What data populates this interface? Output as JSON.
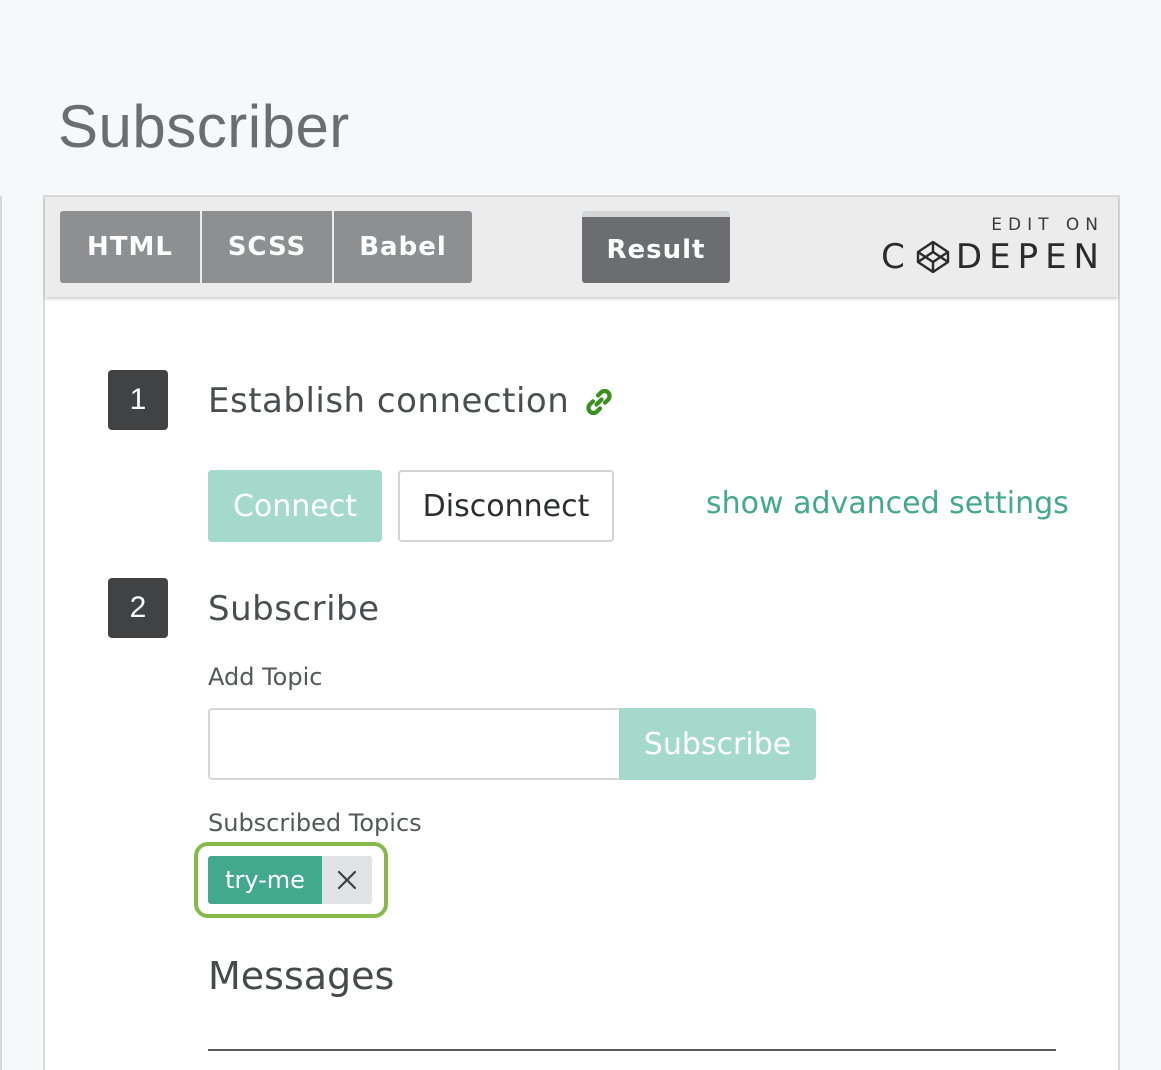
{
  "page": {
    "title": "Subscriber"
  },
  "embed": {
    "tabs": [
      {
        "label": "HTML"
      },
      {
        "label": "SCSS"
      },
      {
        "label": "Babel"
      }
    ],
    "result_tab": {
      "label": "Result",
      "active": true
    },
    "codepen": {
      "edit_on": "EDIT ON",
      "brand_c": "C",
      "brand_rest": "DEPEN"
    }
  },
  "steps": {
    "connection": {
      "number": "1",
      "title": "Establish connection",
      "icon": "link-icon",
      "connect_label": "Connect",
      "disconnect_label": "Disconnect",
      "advanced_link": "show advanced settings"
    },
    "subscribe": {
      "number": "2",
      "title": "Subscribe",
      "add_topic_label": "Add Topic",
      "topic_value": "",
      "subscribe_label": "Subscribe",
      "subscribed_label": "Subscribed Topics",
      "topics": [
        {
          "name": "try-me",
          "remove_icon": "close-icon"
        }
      ]
    }
  },
  "messages": {
    "title": "Messages"
  },
  "colors": {
    "accent": "#43a98c",
    "accent_light": "#a4d9cc",
    "highlight": "#86b94a",
    "badge": "#404244",
    "tab": "#8d8f91",
    "tab_active": "#6b6d70"
  }
}
